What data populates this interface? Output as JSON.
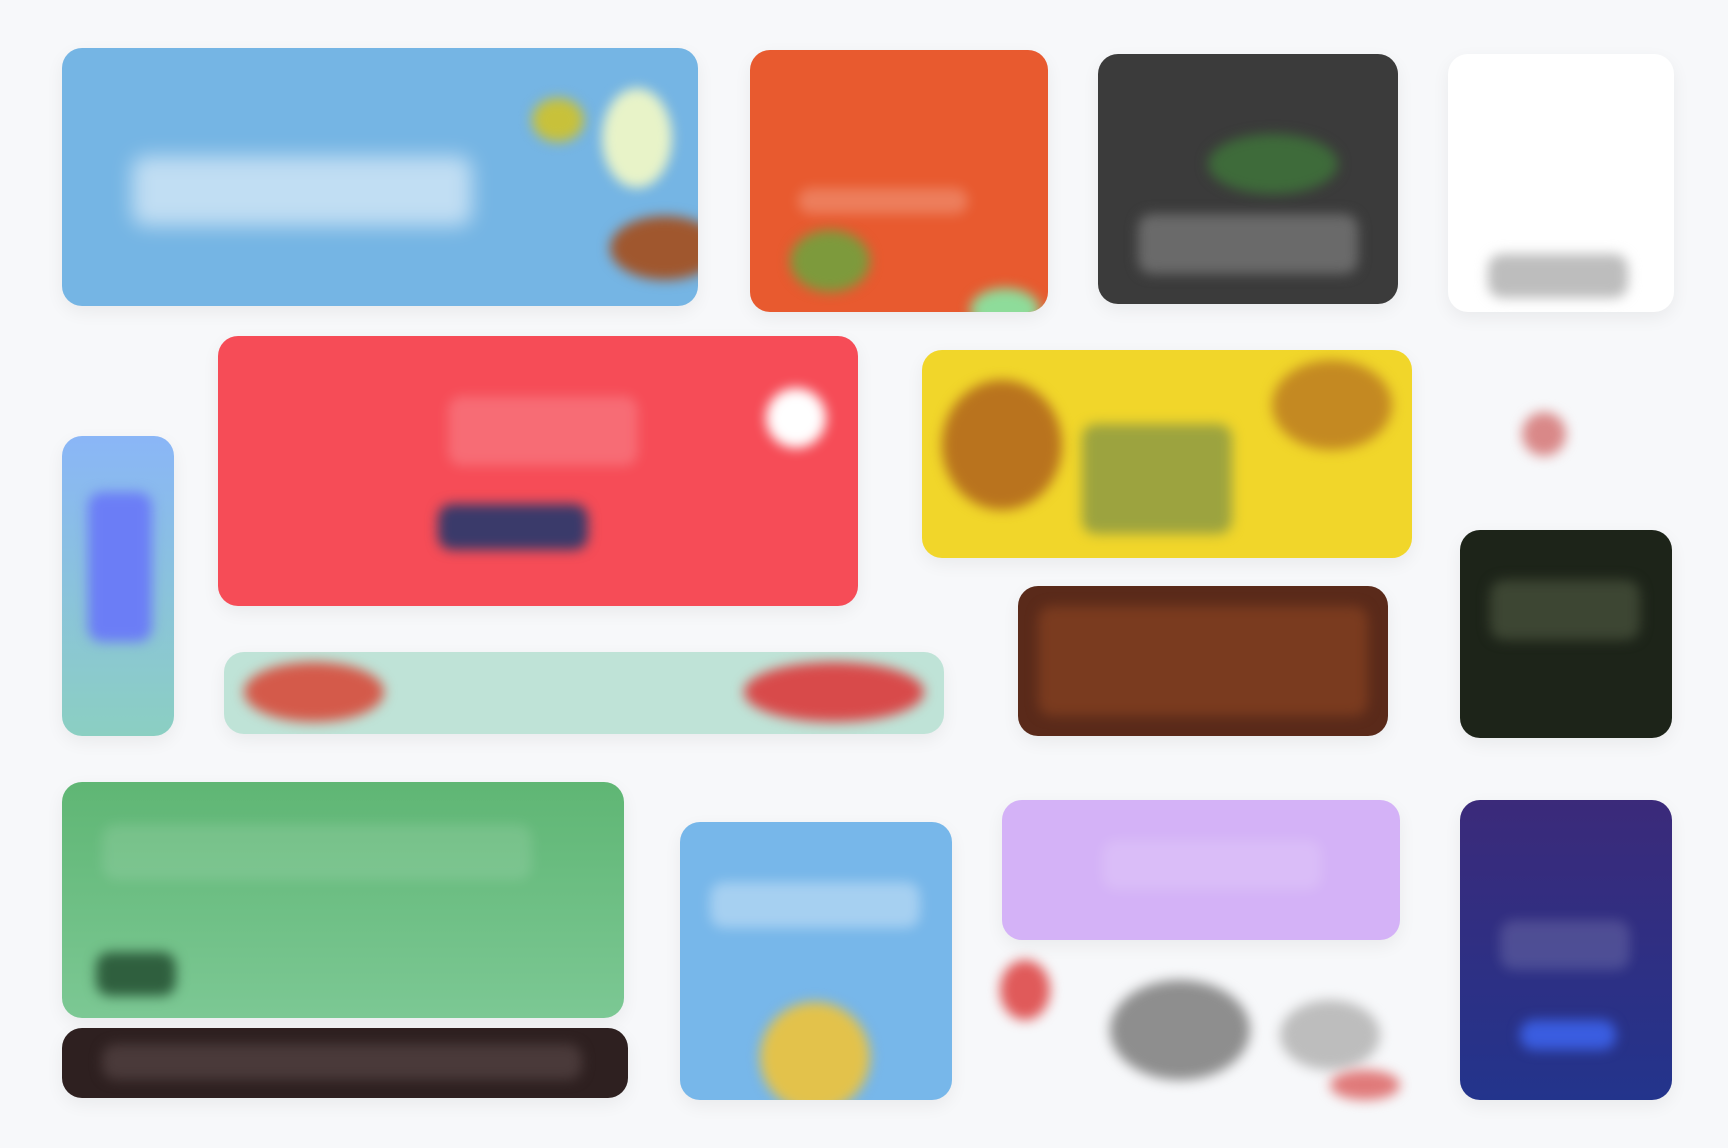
{
  "page": {
    "background": "#f7f8fa"
  },
  "tiles": [
    {
      "name": "tile-blue-banner",
      "color": "#75b5e4",
      "text": ""
    },
    {
      "name": "tile-orange-card",
      "color": "#e85a2f",
      "text": ""
    },
    {
      "name": "tile-dark-photo",
      "color": "#3b3b3b",
      "text": ""
    },
    {
      "name": "tile-white-logo",
      "color": "#ffffff",
      "text": ""
    },
    {
      "name": "tile-red-promo",
      "color": "#f64c57",
      "text": ""
    },
    {
      "name": "tile-yellow-pattern",
      "color": "#f1d62a",
      "text": ""
    },
    {
      "name": "tile-left-slim",
      "color": "#8ab6f7",
      "text": ""
    },
    {
      "name": "tile-mint-strip",
      "color": "#bfe3d7",
      "text": ""
    },
    {
      "name": "tile-brown-photo",
      "color": "#5a2a1a",
      "text": ""
    },
    {
      "name": "tile-dark-green-card",
      "color": "#1d2419",
      "text": ""
    },
    {
      "name": "tile-green-large",
      "color": "#66bd7b",
      "text": ""
    },
    {
      "name": "tile-blue-small",
      "color": "#77b7ea",
      "text": ""
    },
    {
      "name": "tile-lavender-card",
      "color": "#d4b2f7",
      "text": ""
    },
    {
      "name": "tile-navy-card",
      "color": "#23348c",
      "text": ""
    },
    {
      "name": "tile-dark-bottom-strip",
      "color": "#2e2020",
      "text": ""
    }
  ]
}
